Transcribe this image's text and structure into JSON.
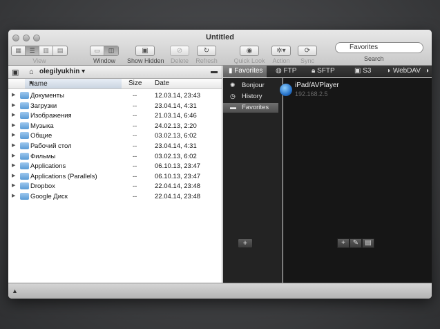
{
  "window": {
    "title": "Untitled"
  },
  "toolbar": {
    "view_label": "View",
    "window_label": "Window",
    "show_hidden_label": "Show Hidden",
    "delete_label": "Delete",
    "refresh_label": "Refresh",
    "quick_look_label": "Quick Look",
    "action_label": "Action",
    "sync_label": "Sync",
    "search_label": "Search",
    "search_value": "Favorites"
  },
  "path_bar": {
    "user": "olegilyukhin"
  },
  "columns": {
    "name": "Name",
    "size": "Size",
    "date": "Date"
  },
  "files": [
    {
      "name": "Документы",
      "size": "--",
      "date": "12.03.14, 23:43"
    },
    {
      "name": "Загрузки",
      "size": "--",
      "date": "23.04.14, 4:31"
    },
    {
      "name": "Изображения",
      "size": "--",
      "date": "21.03.14, 6:46"
    },
    {
      "name": "Музыка",
      "size": "--",
      "date": "24.02.13, 2:20"
    },
    {
      "name": "Общие",
      "size": "--",
      "date": "03.02.13, 6:02"
    },
    {
      "name": "Рабочий стол",
      "size": "--",
      "date": "23.04.14, 4:31"
    },
    {
      "name": "Фильмы",
      "size": "--",
      "date": "03.02.13, 6:02"
    },
    {
      "name": "Applications",
      "size": "--",
      "date": "06.10.13, 23:47"
    },
    {
      "name": "Applications (Parallels)",
      "size": "--",
      "date": "06.10.13, 23:47"
    },
    {
      "name": "Dropbox",
      "size": "--",
      "date": "22.04.14, 23:48"
    },
    {
      "name": "Google Диск",
      "size": "--",
      "date": "22.04.14, 23:48"
    }
  ],
  "tabs": {
    "favorites": "Favorites",
    "ftp": "FTP",
    "sftp": "SFTP",
    "s3": "S3",
    "webdav": "WebDAV"
  },
  "sidebar": {
    "items": [
      {
        "label": "Bonjour"
      },
      {
        "label": "History"
      },
      {
        "label": "Favorites"
      }
    ]
  },
  "device": {
    "name": "iPad/AVPlayer",
    "ip": "192.168.2.5"
  }
}
